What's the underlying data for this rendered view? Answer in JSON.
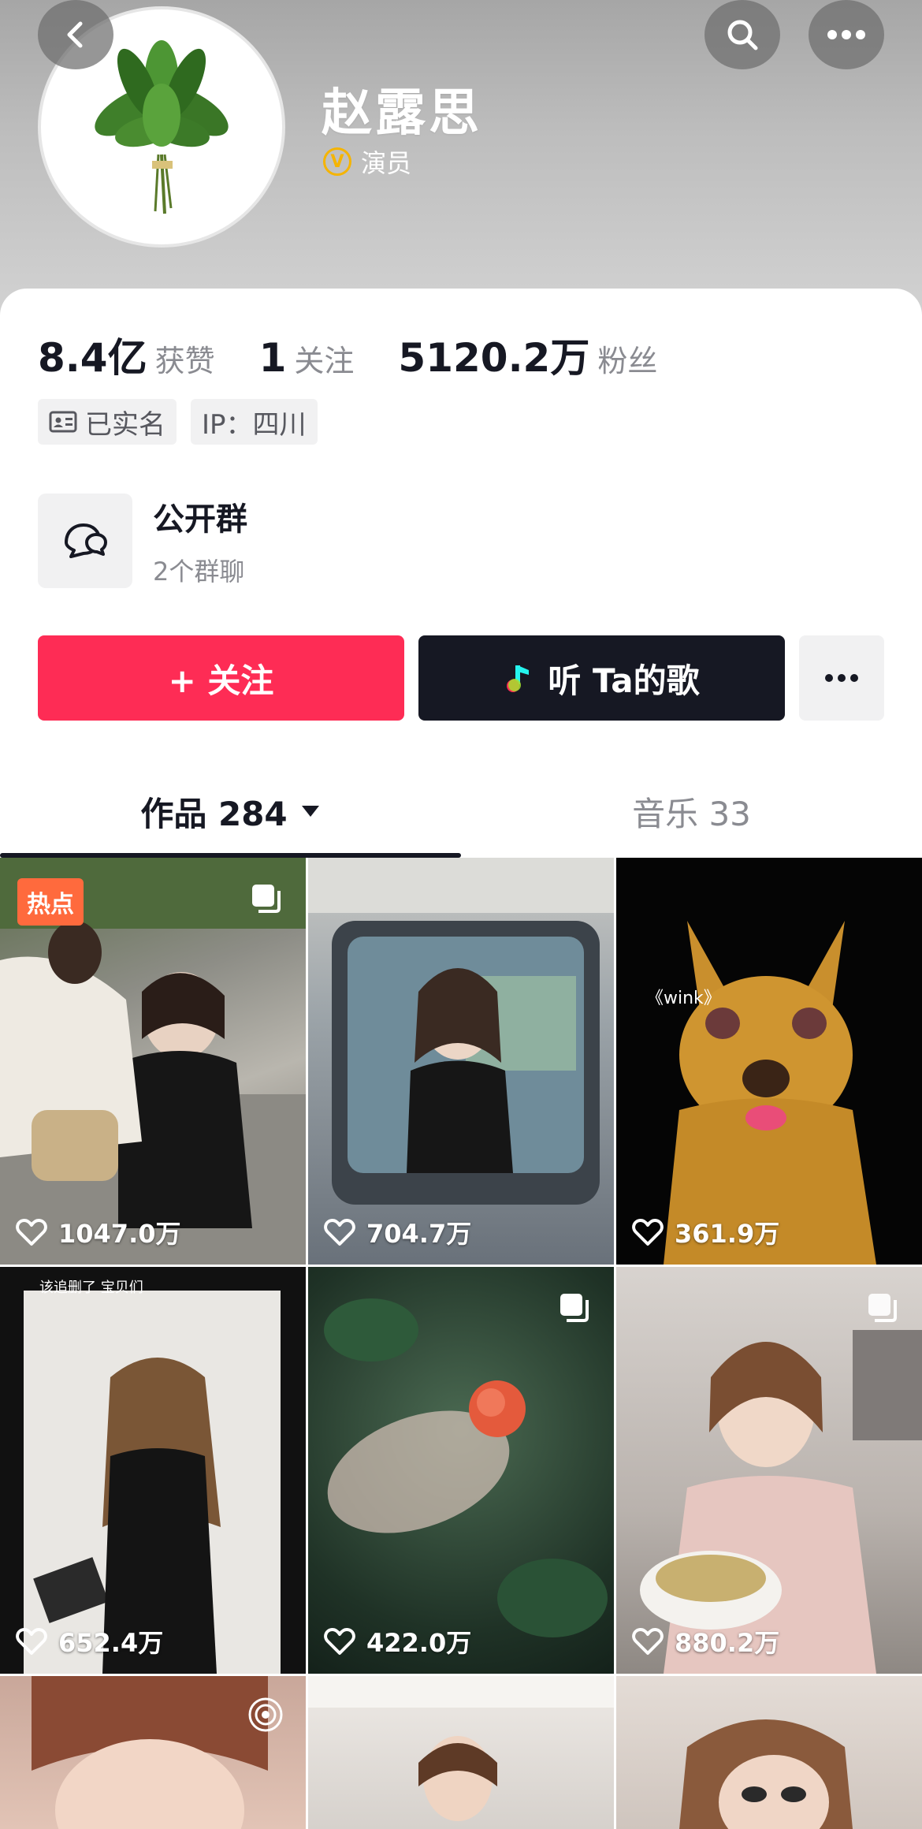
{
  "header": {
    "name": "赵露思",
    "verified_label": "演员",
    "verified_badge": "V"
  },
  "stats": [
    {
      "value": "8.4亿",
      "label": "获赞"
    },
    {
      "value": "1",
      "label": "关注"
    },
    {
      "value": "5120.2万",
      "label": "粉丝"
    }
  ],
  "chips": [
    {
      "label": "已实名",
      "icon": "id-card-icon"
    },
    {
      "label": "IP：四川"
    }
  ],
  "group": {
    "title": "公开群",
    "subtitle": "2个群聊"
  },
  "actions": {
    "follow_label": "+ 关注",
    "music_label": "听 Ta的歌"
  },
  "tabs": {
    "works_label": "作品 284",
    "music_label": "音乐 33"
  },
  "videos": [
    {
      "likes": "1047.0万",
      "badge": "热点"
    },
    {
      "likes": "704.7万"
    },
    {
      "likes": "361.9万",
      "caption": "《wink》"
    },
    {
      "likes": "652.4万",
      "caption": "该追删了 宝贝们"
    },
    {
      "likes": "422.0万"
    },
    {
      "likes": "880.2万"
    }
  ],
  "colors": {
    "follow": "#fe2c55",
    "dark": "#161823",
    "verify": "#f5b400",
    "hot": "#ff6a3d"
  }
}
